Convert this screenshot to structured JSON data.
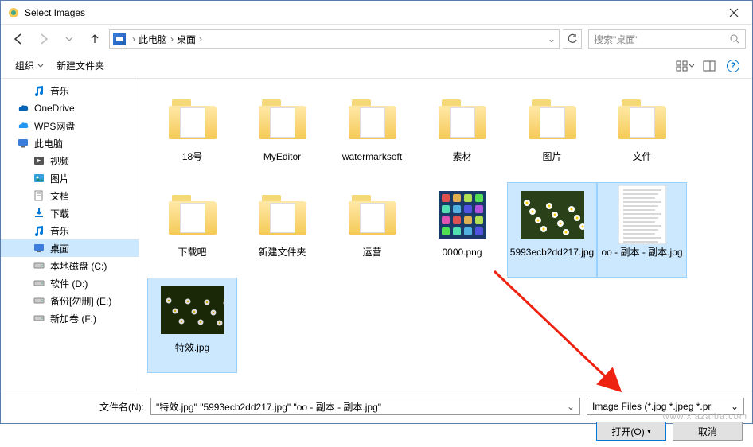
{
  "window": {
    "title": "Select Images"
  },
  "nav": {
    "breadcrumb": [
      "此电脑",
      "桌面"
    ],
    "search_placeholder": "搜索\"桌面\""
  },
  "toolbar": {
    "organize": "组织",
    "new_folder": "新建文件夹"
  },
  "sidebar": [
    {
      "label": "音乐",
      "icon": "music",
      "level": 1
    },
    {
      "label": "OneDrive",
      "icon": "onedrive",
      "level": 0
    },
    {
      "label": "WPS网盘",
      "icon": "wps",
      "level": 0
    },
    {
      "label": "此电脑",
      "icon": "pc",
      "level": 0
    },
    {
      "label": "视频",
      "icon": "video",
      "level": 1
    },
    {
      "label": "图片",
      "icon": "pictures",
      "level": 1
    },
    {
      "label": "文档",
      "icon": "documents",
      "level": 1
    },
    {
      "label": "下载",
      "icon": "downloads",
      "level": 1
    },
    {
      "label": "音乐",
      "icon": "music",
      "level": 1
    },
    {
      "label": "桌面",
      "icon": "desktop",
      "level": 1,
      "selected": true
    },
    {
      "label": "本地磁盘 (C:)",
      "icon": "drive",
      "level": 1
    },
    {
      "label": "软件 (D:)",
      "icon": "drive",
      "level": 1
    },
    {
      "label": "备份[勿删] (E:)",
      "icon": "drive",
      "level": 1
    },
    {
      "label": "新加卷 (F:)",
      "icon": "drive",
      "level": 1
    }
  ],
  "items": [
    {
      "label": "18号",
      "type": "folder"
    },
    {
      "label": "MyEditor",
      "type": "folder"
    },
    {
      "label": "watermarksoft",
      "type": "folder"
    },
    {
      "label": "素材",
      "type": "folder"
    },
    {
      "label": "图片",
      "type": "folder"
    },
    {
      "label": "文件",
      "type": "folder"
    },
    {
      "label": "下载吧",
      "type": "folder"
    },
    {
      "label": "新建文件夹",
      "type": "folder"
    },
    {
      "label": "运营",
      "type": "folder"
    },
    {
      "label": "0000.png",
      "type": "image",
      "thumb": "icons"
    },
    {
      "label": "5993ecb2dd217.jpg",
      "type": "image",
      "thumb": "flowers",
      "selected": true
    },
    {
      "label": "oo - 副本 - 副本.jpg",
      "type": "image",
      "thumb": "doc",
      "selected": true
    },
    {
      "label": "特效.jpg",
      "type": "image",
      "thumb": "flowers-dark",
      "selected": true
    }
  ],
  "footer": {
    "filename_label": "文件名(N):",
    "filename_value": "\"特效.jpg\" \"5993ecb2dd217.jpg\" \"oo - 副本 - 副本.jpg\"",
    "filter": "Image Files (*.jpg *.jpeg *.pr",
    "open": "打开(O)",
    "cancel": "取消"
  },
  "watermark": "www.xiazaiba.com"
}
